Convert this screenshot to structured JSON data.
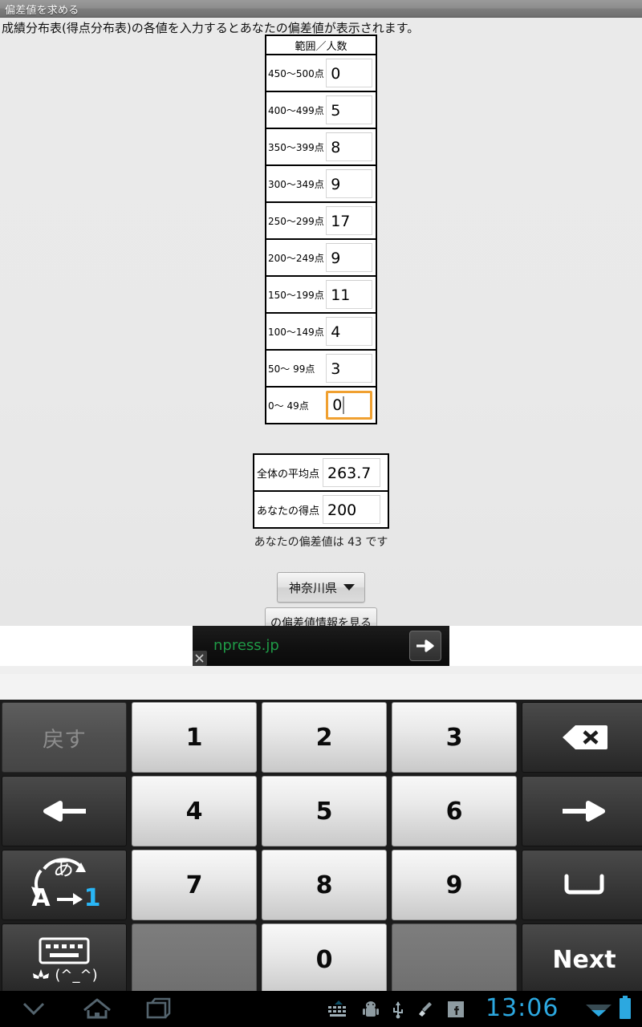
{
  "titlebar": {
    "title": "偏差値を求める"
  },
  "page": {
    "intro": "成績分布表(得点分布表)の各値を入力するとあなたの偏差値が表示されます。",
    "table_header": "範囲／人数",
    "rows": [
      {
        "range": "450〜500点",
        "count": "0"
      },
      {
        "range": "400〜499点",
        "count": "5"
      },
      {
        "range": "350〜399点",
        "count": "8"
      },
      {
        "range": "300〜349点",
        "count": "9"
      },
      {
        "range": "250〜299点",
        "count": "17"
      },
      {
        "range": "200〜249点",
        "count": "9"
      },
      {
        "range": "150〜199点",
        "count": "11"
      },
      {
        "range": "100〜149点",
        "count": "4"
      },
      {
        "range": "50〜 99点",
        "count": "3"
      },
      {
        "range": "0〜 49点",
        "count": "0"
      }
    ],
    "focused_row_index": 9,
    "summary": [
      {
        "label": "全体の平均点",
        "value": "263.7"
      },
      {
        "label": "あなたの得点",
        "value": "200"
      }
    ],
    "result_text": "あなたの偏差値は 43 です",
    "prefecture_selected": "神奈川県",
    "view_button": "の偏差値情報を見る",
    "focus_border_color": "#f0a030"
  },
  "ad": {
    "text": "npress.jp",
    "text_color": "#1f9a46",
    "close_label": "✕",
    "arrow_label": "➡"
  },
  "keyboard": {
    "keys": [
      {
        "label": "戻す",
        "name": "key-undo",
        "type": "disabled"
      },
      {
        "label": "1",
        "name": "key-1",
        "type": "num"
      },
      {
        "label": "2",
        "name": "key-2",
        "type": "num"
      },
      {
        "label": "3",
        "name": "key-3",
        "type": "num"
      },
      {
        "label": "⌫",
        "name": "key-backspace",
        "type": "dark"
      },
      {
        "label": "←",
        "name": "key-arrow-left",
        "type": "dark"
      },
      {
        "label": "4",
        "name": "key-4",
        "type": "num"
      },
      {
        "label": "5",
        "name": "key-5",
        "type": "num"
      },
      {
        "label": "6",
        "name": "key-6",
        "type": "num"
      },
      {
        "label": "→",
        "name": "key-arrow-right",
        "type": "dark"
      },
      {
        "label": "あ A 1",
        "name": "key-input-mode",
        "type": "dark"
      },
      {
        "label": "7",
        "name": "key-7",
        "type": "num"
      },
      {
        "label": "8",
        "name": "key-8",
        "type": "num"
      },
      {
        "label": "9",
        "name": "key-9",
        "type": "num"
      },
      {
        "label": "␣",
        "name": "key-space",
        "type": "dark"
      },
      {
        "label": "(^_^)",
        "name": "key-emoji",
        "type": "dark"
      },
      {
        "label": "",
        "name": "key-blank-left",
        "type": "blank"
      },
      {
        "label": "0",
        "name": "key-0",
        "type": "num"
      },
      {
        "label": "",
        "name": "key-blank-right",
        "type": "blank"
      },
      {
        "label": "Next",
        "name": "key-next",
        "type": "dark"
      }
    ],
    "mode_glyphs": {
      "kana": "あ",
      "alpha": "A",
      "numeric": "1"
    },
    "numeric_highlight_color": "#29b6f6"
  },
  "navbar": {
    "back_icon": "chevron-down-icon",
    "home_icon": "home-icon",
    "recents_icon": "recents-icon",
    "status_icons": [
      "keyboard-icon",
      "android-icon",
      "usb-icon",
      "broom-icon",
      "facebook-icon"
    ],
    "clock": "13:06",
    "wifi_icon": "wifi-icon",
    "battery_icon": "battery-icon",
    "accent_color": "#2ca8e0"
  }
}
